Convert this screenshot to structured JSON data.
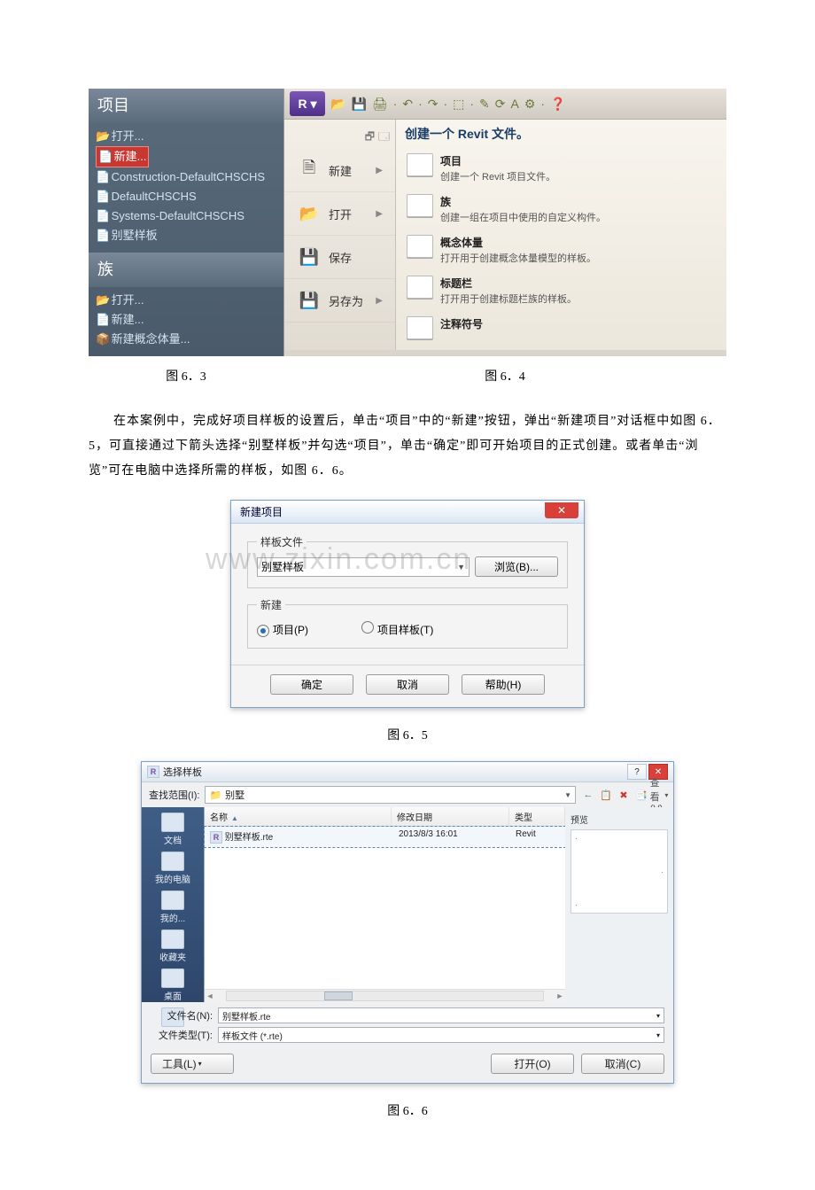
{
  "fig63": {
    "header_projects": "项目",
    "items_projects": [
      {
        "icon": "📂",
        "label": "打开..."
      },
      {
        "icon": "📄",
        "label": "新建...",
        "highlight": true
      },
      {
        "icon": "📄",
        "label": "Construction-DefaultCHSCHS"
      },
      {
        "icon": "📄",
        "label": "DefaultCHSCHS"
      },
      {
        "icon": "📄",
        "label": "Systems-DefaultCHSCHS"
      },
      {
        "icon": "📄",
        "label": "别墅样板"
      }
    ],
    "header_family": "族",
    "items_family": [
      {
        "icon": "📂",
        "label": "打开..."
      },
      {
        "icon": "📄",
        "label": "新建..."
      },
      {
        "icon": "📦",
        "label": "新建概念体量..."
      }
    ],
    "caption": "图 6．3"
  },
  "fig64": {
    "app_glyph": "R ▾",
    "qat_icons": [
      "📂",
      "💾",
      "🖨",
      "·",
      "↶",
      "·",
      "↷",
      "·",
      "⬚",
      "·",
      "✎",
      "⟳",
      "A",
      "⚙",
      "·",
      "❓"
    ],
    "mini_toolbar": [
      "🗗",
      "🗔"
    ],
    "left_menu": [
      {
        "glyph": "🗎",
        "label": "新建",
        "arrow": true
      },
      {
        "glyph": "📂",
        "label": "打开",
        "arrow": true
      },
      {
        "glyph": "💾",
        "label": "保存"
      },
      {
        "glyph": "💾",
        "label": "另存为",
        "arrow": true
      }
    ],
    "hint": "创建一个 Revit 文件。",
    "right_items": [
      {
        "title": "项目",
        "desc": "创建一个 Revit 项目文件。"
      },
      {
        "title": "族",
        "desc": "创建一组在项目中使用的自定义构件。"
      },
      {
        "title": "概念体量",
        "desc": "打开用于创建概念体量模型的样板。"
      },
      {
        "title": "标题栏",
        "desc": "打开用于创建标题栏族的样板。"
      },
      {
        "title": "注释符号",
        "desc": ""
      }
    ],
    "caption": "图 6．4"
  },
  "paragraph": "在本案例中，完成好项目样板的设置后，单击“项目”中的“新建”按钮，弹出“新建项目”对话框中如图 6．5，可直接通过下箭头选择“别墅样板”并勾选“项目”，单击“确定”即可开始项目的正式创建。或者单击“浏览”可在电脑中选择所需的样板，如图 6．6。",
  "watermark": "www.zixin.com.cn",
  "fig65": {
    "title": "新建项目",
    "group_template": "样板文件",
    "combo_value": "别墅样板",
    "browse": "浏览(B)...",
    "group_new": "新建",
    "radio_project": "项目(P)",
    "radio_template": "项目样板(T)",
    "ok": "确定",
    "cancel": "取消",
    "help": "帮助(H)",
    "caption": "图 6．5"
  },
  "fig66": {
    "title": "选择样板",
    "lookin_label": "查找范围(I):",
    "lookin_value": "别墅",
    "tool_icons": [
      "←",
      "📋",
      "✖",
      "📑"
    ],
    "view_label": "查看(V)",
    "places": [
      "文档",
      "我的电脑",
      "我的...",
      "收藏夹",
      "桌面",
      ""
    ],
    "cols": {
      "name": "名称",
      "date": "修改日期",
      "type": "类型"
    },
    "row": {
      "name": "别墅样板.rte",
      "date": "2013/8/3 16:01",
      "type": "Revit"
    },
    "preview_label": "预览",
    "filename_label": "文件名(N):",
    "filename_value": "别墅样板.rte",
    "filetype_label": "文件类型(T):",
    "filetype_value": "样板文件 (*.rte)",
    "tools_btn": "工具(L)",
    "open_btn": "打开(O)",
    "cancel_btn": "取消(C)",
    "caption": "图 6．6"
  }
}
